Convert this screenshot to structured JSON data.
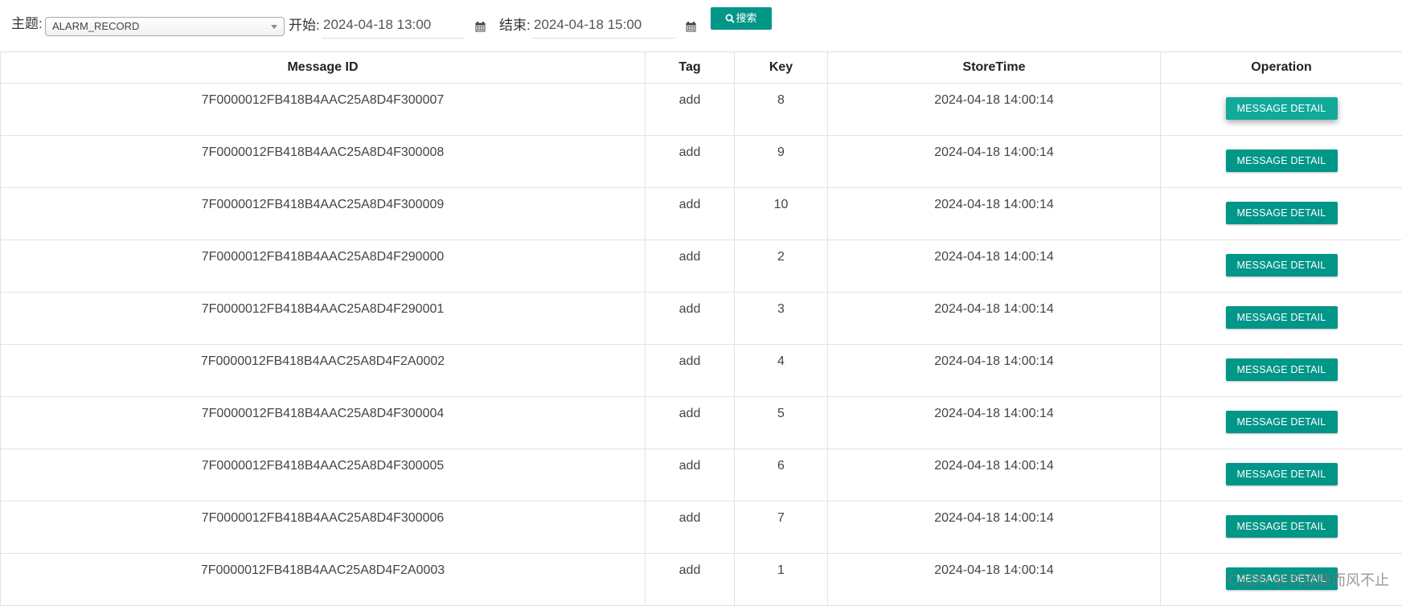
{
  "toolbar": {
    "topic_label": "主题:",
    "topic_value": "ALARM_RECORD",
    "start_label": "开始:",
    "start_value": "2024-04-18 13:00",
    "end_label": "结束:",
    "end_value": "2024-04-18 15:00",
    "search_label": "搜索",
    "accent_color": "#009688"
  },
  "table": {
    "headers": [
      "Message ID",
      "Tag",
      "Key",
      "StoreTime",
      "Operation"
    ],
    "button_label": "MESSAGE DETAIL",
    "rows": [
      {
        "id": "7F0000012FB418B4AAC25A8D4F300007",
        "tag": "add",
        "key": "8",
        "time": "2024-04-18 14:00:14"
      },
      {
        "id": "7F0000012FB418B4AAC25A8D4F300008",
        "tag": "add",
        "key": "9",
        "time": "2024-04-18 14:00:14"
      },
      {
        "id": "7F0000012FB418B4AAC25A8D4F300009",
        "tag": "add",
        "key": "10",
        "time": "2024-04-18 14:00:14"
      },
      {
        "id": "7F0000012FB418B4AAC25A8D4F290000",
        "tag": "add",
        "key": "2",
        "time": "2024-04-18 14:00:14"
      },
      {
        "id": "7F0000012FB418B4AAC25A8D4F290001",
        "tag": "add",
        "key": "3",
        "time": "2024-04-18 14:00:14"
      },
      {
        "id": "7F0000012FB418B4AAC25A8D4F2A0002",
        "tag": "add",
        "key": "4",
        "time": "2024-04-18 14:00:14"
      },
      {
        "id": "7F0000012FB418B4AAC25A8D4F300004",
        "tag": "add",
        "key": "5",
        "time": "2024-04-18 14:00:14"
      },
      {
        "id": "7F0000012FB418B4AAC25A8D4F300005",
        "tag": "add",
        "key": "6",
        "time": "2024-04-18 14:00:14"
      },
      {
        "id": "7F0000012FB418B4AAC25A8D4F300006",
        "tag": "add",
        "key": "7",
        "time": "2024-04-18 14:00:14"
      },
      {
        "id": "7F0000012FB418B4AAC25A8D4F2A0003",
        "tag": "add",
        "key": "1",
        "time": "2024-04-18 14:00:14"
      }
    ]
  },
  "watermark": "CSDN @树欲静而风不止"
}
